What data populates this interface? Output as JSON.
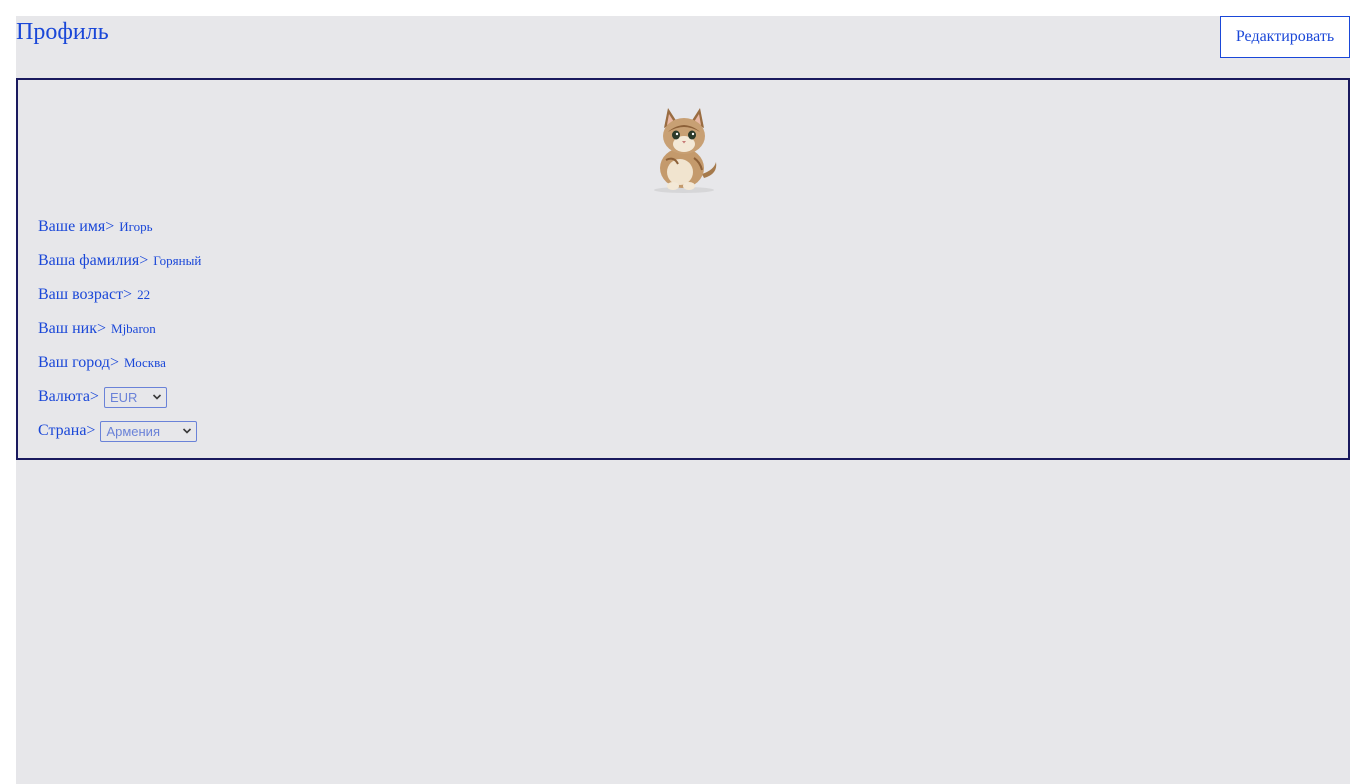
{
  "header": {
    "title": "Профиль",
    "edit_label": "Редактировать"
  },
  "profile": {
    "avatar_icon": "kitten-photo",
    "fields": [
      {
        "label": "Ваше имя>",
        "value": "Игорь"
      },
      {
        "label": "Ваша фамилия>",
        "value": "Горяный"
      },
      {
        "label": "Ваш возраст>",
        "value": "22"
      },
      {
        "label": "Ваш ник>",
        "value": "Mjbaron"
      },
      {
        "label": "Ваш город>",
        "value": "Москва"
      }
    ],
    "currency": {
      "label": "Валюта>",
      "selected": "EUR"
    },
    "country": {
      "label": "Страна>",
      "selected": "Армения"
    }
  },
  "colors": {
    "accent": "#1a47d8",
    "background": "#e7e7ea",
    "border": "#1a1a5e"
  }
}
